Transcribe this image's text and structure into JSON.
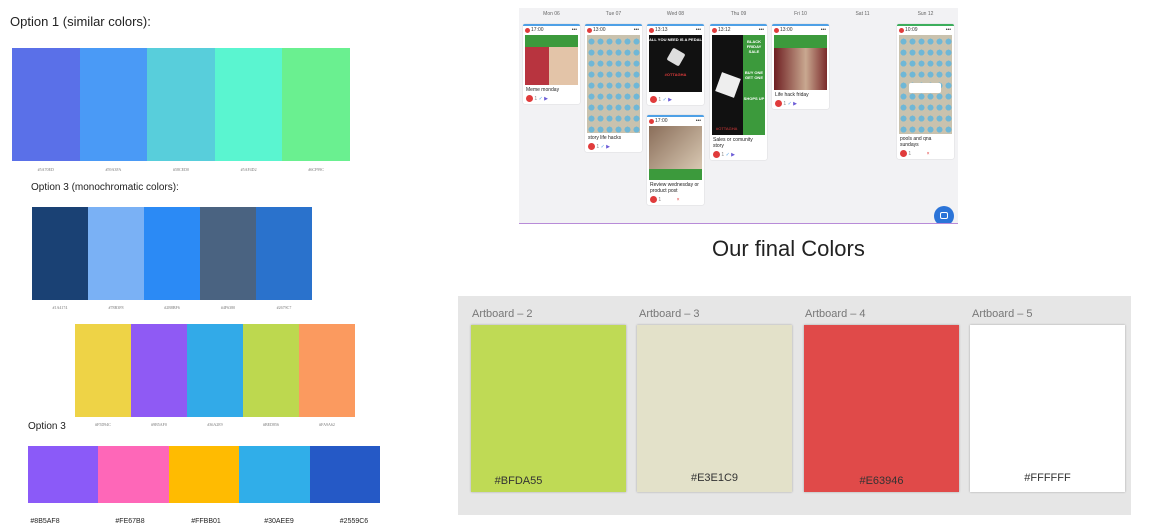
{
  "option1": {
    "title": "Option 1 (similar colors):",
    "swatches": [
      "#5A70E8",
      "#4A9AF6",
      "#58CEDB",
      "#5AF5D0",
      "#6AF090"
    ],
    "hex_labels": [
      "#5A70ED",
      "#59A3FA",
      "#58CED0",
      "#5AF4D2",
      "#6CF99C"
    ]
  },
  "option3_mono": {
    "title": "Option 3 (monochromatic colors):",
    "swatches": [
      "#1A4174",
      "#7AB1F5",
      "#2B8AF5",
      "#4A6381",
      "#2A72CC"
    ],
    "hex_labels": [
      "#1A4174",
      "#78B3F8",
      "#2B8BF6",
      "#4F6380",
      "#2679C7"
    ]
  },
  "palette_unlabeled": {
    "swatches": [
      "#EED346",
      "#8F5AF4",
      "#32AAE8",
      "#BDD84F",
      "#FB9A5F"
    ],
    "hex_labels": [
      "#F5D94C",
      "#9B5AF0",
      "#36A2E9",
      "#BED856",
      "#FA9A62"
    ]
  },
  "option3": {
    "title": "Option 3",
    "swatches": [
      "#8B5AF8",
      "#FE67B8",
      "#FFBB01",
      "#30AEE9",
      "#2559C6"
    ],
    "hex_labels": [
      "#8B5AF8",
      "#FE67B8",
      "#FFBB01",
      "#30AEE9",
      "#2559C6"
    ]
  },
  "calendar": {
    "days": [
      "Mon 06",
      "Tue 07",
      "Wed 08",
      "Thu 09",
      "Fri 10",
      "Sat 11",
      "Sun 12"
    ],
    "accent_colors": [
      "#4ea0e6",
      "#4ea0e6",
      "#4ea0e6",
      "#4ea0e6",
      "#4ea0e6",
      "",
      "#3cae5c"
    ],
    "cards": {
      "mon": {
        "time": "17:00",
        "caption": "Meme monday"
      },
      "tue": {
        "time": "13:00",
        "caption": "story life hacks"
      },
      "wed1": {
        "time": "13:13",
        "banner": "ALL YOU NEED IS A PEDAL",
        "brand": "#OTTAGHA"
      },
      "wed2": {
        "time": "17:00",
        "caption": "Review wednesday or product post"
      },
      "thu": {
        "time": "13:12",
        "banner": "BLACK FRIDAY SALE",
        "offer": "BUY ONE GET ONE",
        "cta": "SHOPS UP",
        "brand": "#OTTAGHA",
        "caption": "Sales or comunity story"
      },
      "fri": {
        "time": "13:00",
        "caption": "Life hack friday"
      },
      "sun": {
        "time": "10:09",
        "caption": "pools and qna sundays"
      }
    },
    "footer_count": "1"
  },
  "final": {
    "title": "Our final Colors",
    "artboards": [
      {
        "name": "Artboard – 2",
        "hex": "#BFDA55",
        "color": "#BFDA55"
      },
      {
        "name": "Artboard – 3",
        "hex": "#E3E1C9",
        "color": "#E3E1C9"
      },
      {
        "name": "Artboard – 4",
        "hex": "#E63946",
        "color": "#E04A49"
      },
      {
        "name": "Artboard – 5",
        "hex": "#FFFFFF",
        "color": "#FFFFFF"
      }
    ]
  }
}
